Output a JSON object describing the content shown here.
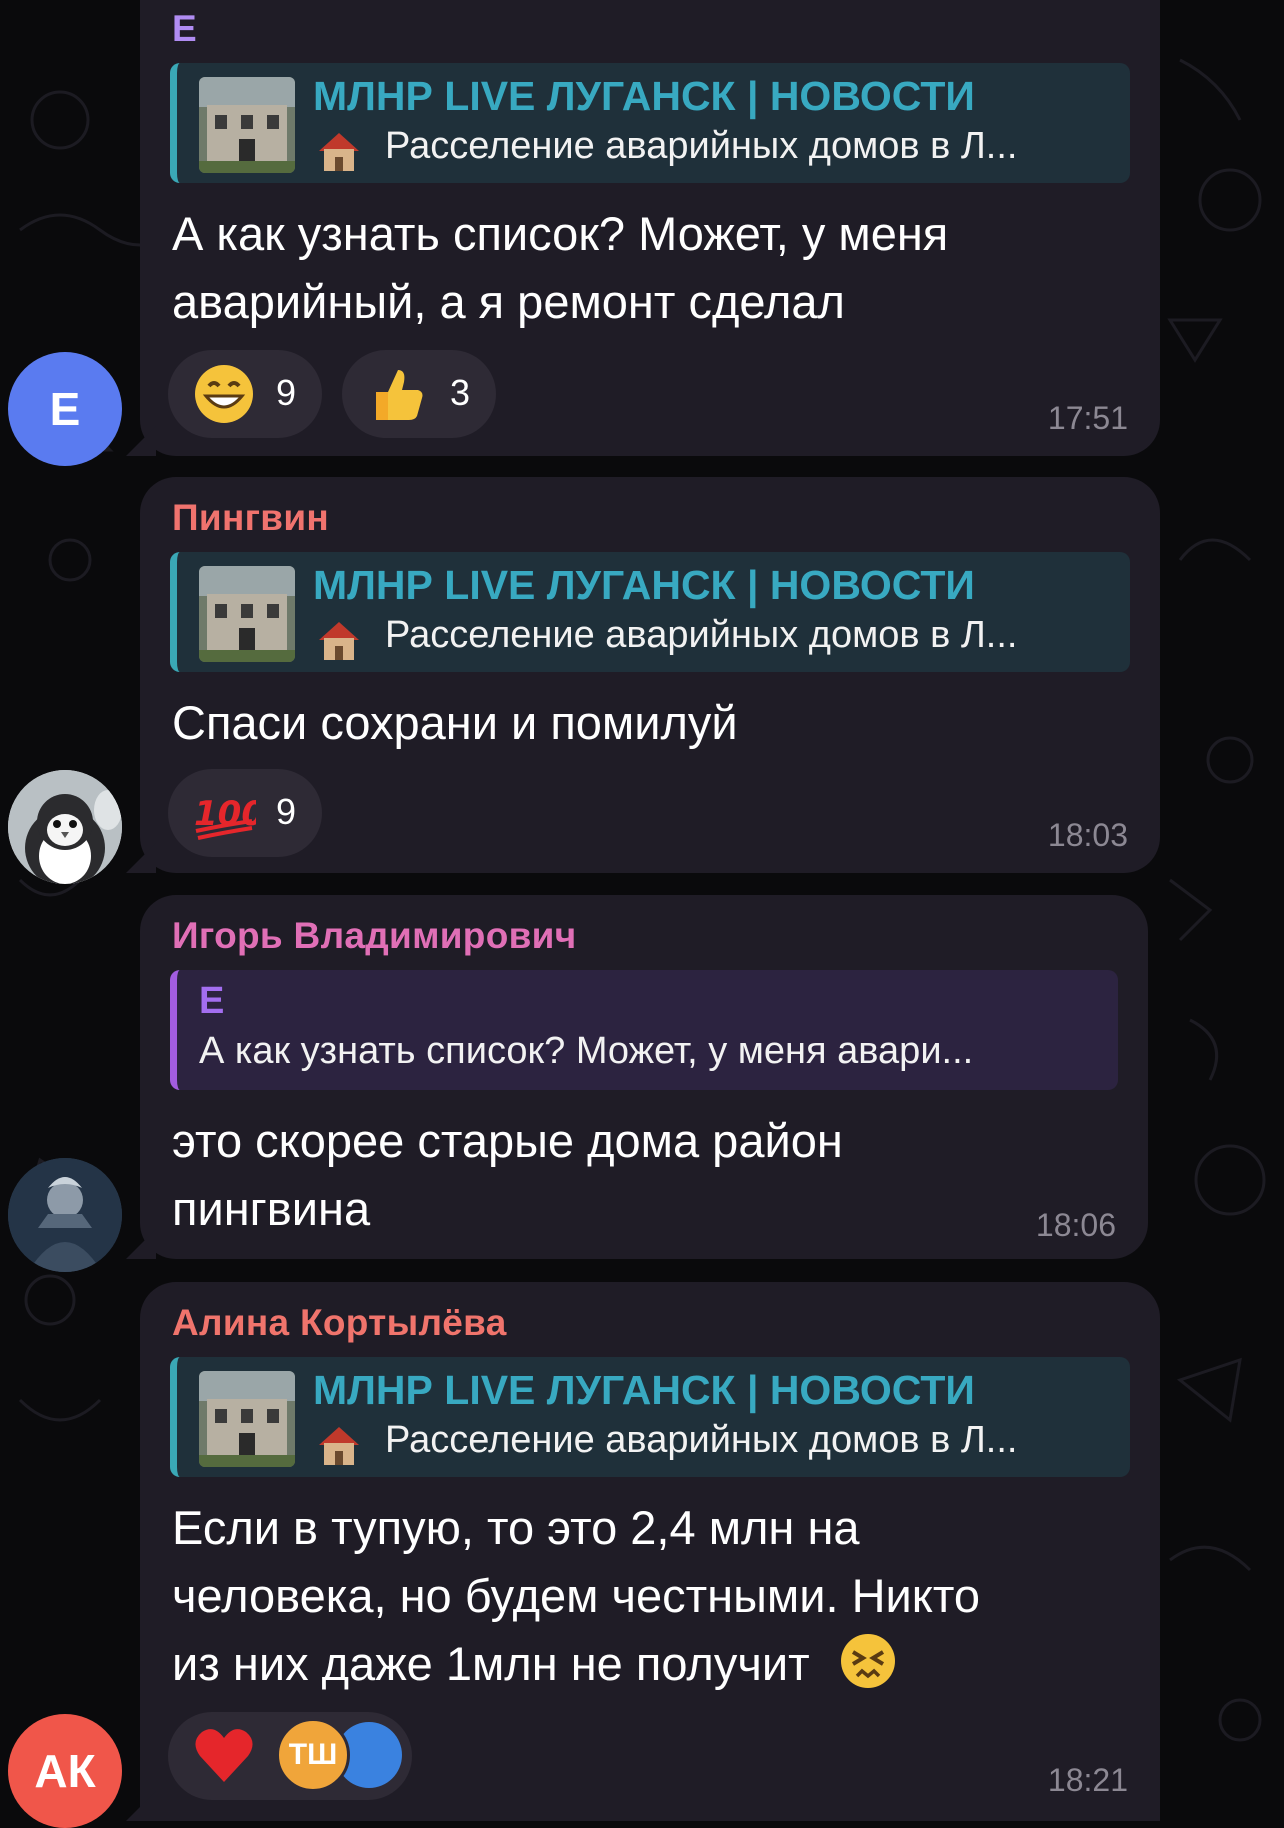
{
  "colors": {
    "background": "#0a0a0c",
    "bubble": "#1f1c26",
    "channel_accent": "#38a9c1",
    "reply_purple": "#a35de0",
    "time": "#8c8893"
  },
  "messages": [
    {
      "sender": "Е",
      "sender_color": "#b08cf2",
      "reply": {
        "title": "МЛНР LIVE ЛУГАНСК | НОВОСТИ",
        "text": "Расселение аварийных домов в Л..."
      },
      "text_lines": [
        "А как узнать список? Может, у меня",
        "аварийный, а я ремонт сделал"
      ],
      "reactions": [
        {
          "emoji": "grinning-face",
          "count": "9"
        },
        {
          "emoji": "thumbs-up",
          "count": "3"
        }
      ],
      "time": "17:51",
      "avatar": {
        "type": "letter",
        "letter": "Е",
        "color": "#5a7bf0"
      }
    },
    {
      "sender": "Пингвин",
      "sender_color": "#f0736e",
      "reply": {
        "title": "МЛНР LIVE ЛУГАНСК | НОВОСТИ",
        "text": "Расселение аварийных домов в Л..."
      },
      "text_lines": [
        "Спаси сохрани и помилуй"
      ],
      "reactions": [
        {
          "emoji": "hundred-points",
          "count": "9"
        }
      ],
      "time": "18:03",
      "avatar": {
        "type": "image",
        "icon": "penguin-avatar"
      }
    },
    {
      "sender": "Игорь Владимирович",
      "sender_color": "#e06fb6",
      "reply": {
        "name": "Е",
        "text": "А как узнать список? Может, у меня авари..."
      },
      "text_lines": [
        "это скорее старые дома район",
        "пингвина"
      ],
      "time": "18:06",
      "avatar": {
        "type": "image",
        "icon": "warrior-avatar"
      }
    },
    {
      "sender": "Алина Кортылёва",
      "sender_color": "#f0746c",
      "reply": {
        "title": "МЛНР LIVE ЛУГАНСК | НОВОСТИ",
        "text": "Расселение аварийных домов в Л..."
      },
      "text_lines": [
        "Если в тупую, то это 2,4 млн на",
        "человека, но будем честными. Никто",
        "из них даже 1млн не получит"
      ],
      "reactions": [
        {
          "emoji": "red-heart",
          "reactor_initials": "ТШ"
        }
      ],
      "time": "18:21",
      "avatar": {
        "type": "letter",
        "letter": "АК",
        "color": "#f0564a"
      }
    }
  ]
}
